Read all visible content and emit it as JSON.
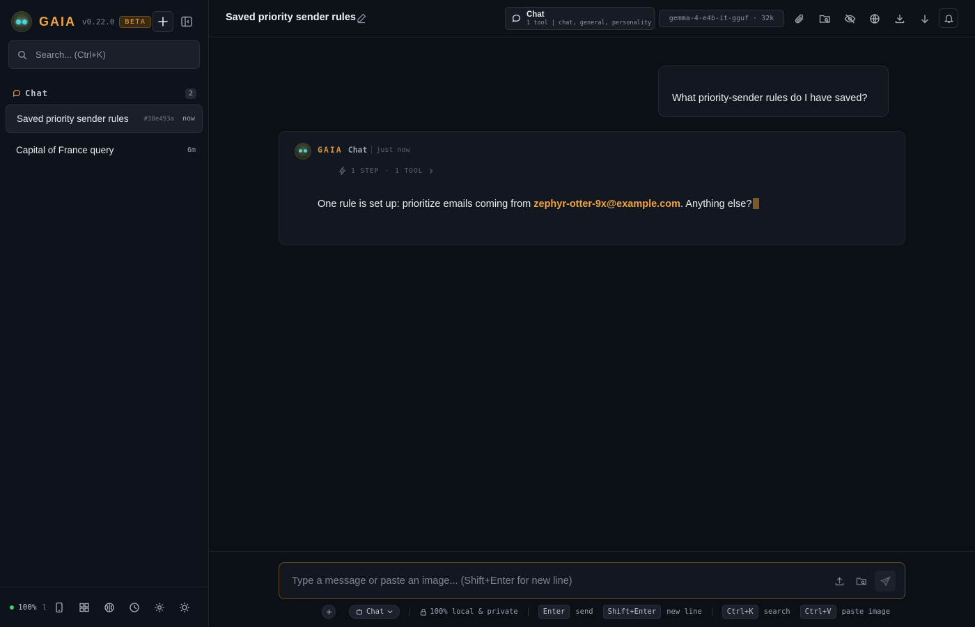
{
  "sidebar": {
    "brand": "GAIA",
    "version": "v0.22.0",
    "beta": "BETA",
    "search_placeholder": "Search... (Ctrl+K)",
    "section": {
      "label": "Chat",
      "count": "2"
    },
    "conversations": [
      {
        "title": "Saved priority sender rules",
        "hash": "#38e493a",
        "time": "now"
      },
      {
        "title": "Capital of France query",
        "time": "6m"
      }
    ],
    "footer": {
      "percent": "100%",
      "tick": "l"
    }
  },
  "topbar": {
    "title": "Saved priority sender rules",
    "mode_title": "Chat",
    "mode_subtitle": "1 tool | chat, general, personality",
    "model": "gemma-4-e4b-it-gguf · 32k"
  },
  "messages": {
    "user": "What priority-sender rules do I have saved?",
    "bot": {
      "name": "GAIA",
      "mode": "Chat",
      "time": "just now",
      "steps": "1 STEP",
      "tools": "1 TOOL",
      "text_before": "One rule is set up: prioritize emails coming from ",
      "email": "zephyr-otter-9x@example.com",
      "text_after": ". Anything else?"
    }
  },
  "composer": {
    "placeholder": "Type a message or paste an image... (Shift+Enter for new line)",
    "mode_chip": "Chat",
    "privacy": "100% local & private",
    "hints": [
      {
        "key": "Enter",
        "label": "send"
      },
      {
        "key": "Shift+Enter",
        "label": "new line"
      },
      {
        "key": "Ctrl+K",
        "label": "search"
      },
      {
        "key": "Ctrl+V",
        "label": "paste image"
      }
    ]
  },
  "colors": {
    "accent": "#f0a340",
    "background": "#0b0f16",
    "status_green": "#3ecf6e"
  }
}
